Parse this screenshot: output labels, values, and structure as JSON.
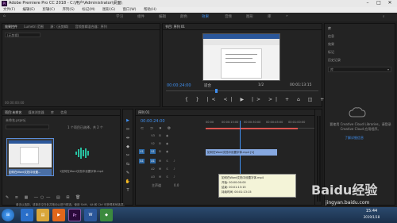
{
  "window": {
    "title": "Adobe Premiere Pro CC 2018 - C:\\用户\\Administrator\\桌面\\",
    "app_logo": "Pr"
  },
  "menu": {
    "items": [
      "文件(F)",
      "编辑(E)",
      "剪辑(C)",
      "序列(S)",
      "标记(M)",
      "图形(G)",
      "窗口(W)",
      "帮助(H)"
    ]
  },
  "workspaces": {
    "items": [
      "学习",
      "组件",
      "编辑",
      "颜色",
      "效果",
      "音频",
      "图形",
      "库"
    ],
    "active_index": 4
  },
  "source_panel": {
    "tabs": [
      "效果控件",
      "Lumetri 范围",
      "源：(无剪辑)",
      "音频剪辑混合器：序列"
    ],
    "no_clip_text": "(无剪辑)",
    "timecode": "00:00:00:00"
  },
  "program_monitor": {
    "tab": "节目: 序列 01",
    "timecode_left": "00:00:24:00",
    "fit": "适合",
    "fraction": "1/2",
    "timecode_right": "00:01:13:15",
    "controls": [
      "{",
      "}",
      "|<",
      "<|",
      "▶",
      "|>",
      ">|",
      "+",
      "⌂",
      "◫",
      "+"
    ]
  },
  "libraries_panel": {
    "items": [
      "库",
      "信息",
      "效果",
      "标记",
      "历史记录"
    ],
    "selected_library": "库",
    "cloud_message": "要使用 Creative Cloud Libraries，请登录 Creative Cloud 应用程序。",
    "cloud_link": "了解详细信息"
  },
  "project_panel": {
    "tabs": [
      "项目:未命名",
      "媒体浏览器",
      "库",
      "信息"
    ],
    "file_name": "未命名.prproj",
    "search_placeholder": "",
    "item_count": "1 个项目已选择，共 2 个",
    "items": [
      {
        "name": "如何在Word文档中设置...",
        "duration": "1:13:15",
        "kind": "video"
      },
      {
        "name": "1如何在Word文档中设置字体.mp4",
        "duration": "1:13:15",
        "kind": "audio"
      }
    ]
  },
  "tools": {
    "items": [
      "▶",
      "⇔",
      "⇹",
      "◆",
      "✂",
      "⇆",
      "✎",
      "✋",
      "T"
    ],
    "active_index": 0
  },
  "timeline": {
    "tab": "序列 01",
    "timecode": "00:00:24:00",
    "ruler_labels": [
      "00:00",
      "00:00:15:00",
      "00:00:30:00",
      "00:00:45:00",
      "00:01:00:00"
    ],
    "video_tracks": [
      "V3",
      "V2",
      "V1"
    ],
    "audio_tracks": [
      "A1",
      "A2",
      "A3"
    ],
    "master_label": "主声道",
    "master_value": "0.0",
    "clip_label": "如何在Word文档中设置字体.mp4 [V]",
    "tooltip": {
      "title": "如何在Word文档中设置字体.mp4",
      "start": "开始: 00:00:00:00",
      "end": "结束: 00:01:13:15",
      "duration": "持续时间: 00:01:13:15"
    }
  },
  "statusbar": {
    "text": "单击以选择，或单击空白处并拖动以进行框选。使用 Shift、Alt 和 Ctrl 可获得其他选项。"
  },
  "taskbar": {
    "time": "15:44",
    "date": "2019/1/18",
    "apps": [
      "start",
      "ie",
      "explorer",
      "media",
      "pr",
      "word",
      "other"
    ]
  },
  "watermark": {
    "text": "Baidu经验",
    "url": "jingyan.baidu.com"
  },
  "colors": {
    "accent_blue": "#3f8ff0",
    "playhead_red": "#d9534f",
    "clip_blue": "#86a8e0"
  }
}
